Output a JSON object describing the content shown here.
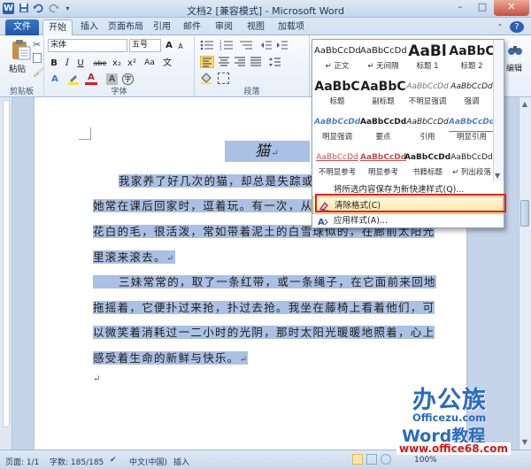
{
  "window": {
    "title": "文档2 [兼容模式] - Microsoft Word",
    "minimize": "–",
    "maximize": "□",
    "close": "✕",
    "app_icon_letter": "W",
    "qa_icons": [
      "save-icon",
      "undo-icon",
      "redo-icon"
    ]
  },
  "tabs": [
    "文件",
    "开始",
    "插入",
    "页面布局",
    "引用",
    "邮件",
    "审阅",
    "视图",
    "加载项"
  ],
  "help": "?",
  "ribbon": {
    "clipboard": {
      "paste_label": "粘贴",
      "group_label": "剪贴板"
    },
    "font": {
      "name": "宋体",
      "size": "五号",
      "group_label": "字体",
      "bold": "B",
      "italic": "I",
      "underline": "U",
      "strike": "abe",
      "subscript": "x₂",
      "superscript": "x²",
      "grow": "A",
      "shrink": "A",
      "color_a": "A",
      "aa": "Aa",
      "wen": "文",
      "char_a": "A"
    },
    "paragraph": {
      "group_label": "段落"
    },
    "editing": {
      "label": "编辑"
    }
  },
  "document": {
    "title": "猫",
    "lines": [
      {
        "text": "我家养了好几次的猫，却总是失踪或死",
        "indent": true
      },
      {
        "text": "她常在课后回家时，逗着玩。有一次，从隔壁要来一只小猫，",
        "indent": false
      },
      {
        "text": "花白的毛，很活泼，常如带着泥土的白雪球似的，在廊前太阳光",
        "indent": false
      },
      {
        "text": "里滚来滚去。",
        "indent": false
      },
      {
        "text": "三妹常常的，取了一条红带，或一条绳子，在它面前来回地",
        "indent": true
      },
      {
        "text": "拖摇着，它便扑过来抢，扑过去抢。我坐在藤椅上看着他们，可",
        "indent": false
      },
      {
        "text": "以微笑着消耗过一二小时的光阴，那时太阳光暖暖地照着，心上",
        "indent": false
      },
      {
        "text": "感受着生命的新鲜与快乐。",
        "indent": false
      }
    ],
    "pilcrow": "↵"
  },
  "styles_gallery": {
    "items": [
      {
        "preview": "AaBbCcDd",
        "name": "↵ 正文"
      },
      {
        "preview": "AaBbCcDd",
        "name": "↵ 无间隔"
      },
      {
        "preview": "AaBl",
        "name": "标题 1"
      },
      {
        "preview": "AaBbC",
        "name": "标题 2"
      },
      {
        "preview": "AaBbC",
        "name": "标题"
      },
      {
        "preview": "AaBbC",
        "name": "副标题"
      },
      {
        "preview": "AaBbCcDd",
        "name": "不明显强调"
      },
      {
        "preview": "AaBbCcDd",
        "name": "强调"
      },
      {
        "preview": "AaBbCcDd",
        "name": "明显强调"
      },
      {
        "preview": "AaBbCcDd",
        "name": "要点"
      },
      {
        "preview": "AaBbCcDd",
        "name": "引用"
      },
      {
        "preview": "AaBbCcDd",
        "name": "明显引用"
      },
      {
        "preview": "AaBbCcDd",
        "name": "不明显参考"
      },
      {
        "preview": "AaBbCcDd",
        "name": "明显参考"
      },
      {
        "preview": "AaBbCcDd",
        "name": "书籍标题"
      },
      {
        "preview": "AaBbCcDd",
        "name": "↵ 列出段落"
      }
    ],
    "menu": [
      "将所选内容保存为新快速样式(Q)...",
      "清除格式(C)",
      "应用样式(A)..."
    ]
  },
  "statusbar": {
    "page": "页面: 1/1",
    "words": "字数: 185/185",
    "lang": "中文(中国)",
    "mode": "插入",
    "zoom": "100%",
    "minus": "−",
    "plus": "+"
  },
  "watermark": {
    "logo": "办公族",
    "domain": "Officezu.com",
    "product": "Word教程",
    "url": "www.office68.com"
  },
  "colors": {
    "accent": "#1f57a8",
    "selection": "#aac0e4",
    "highlight_box": "#e02020"
  }
}
